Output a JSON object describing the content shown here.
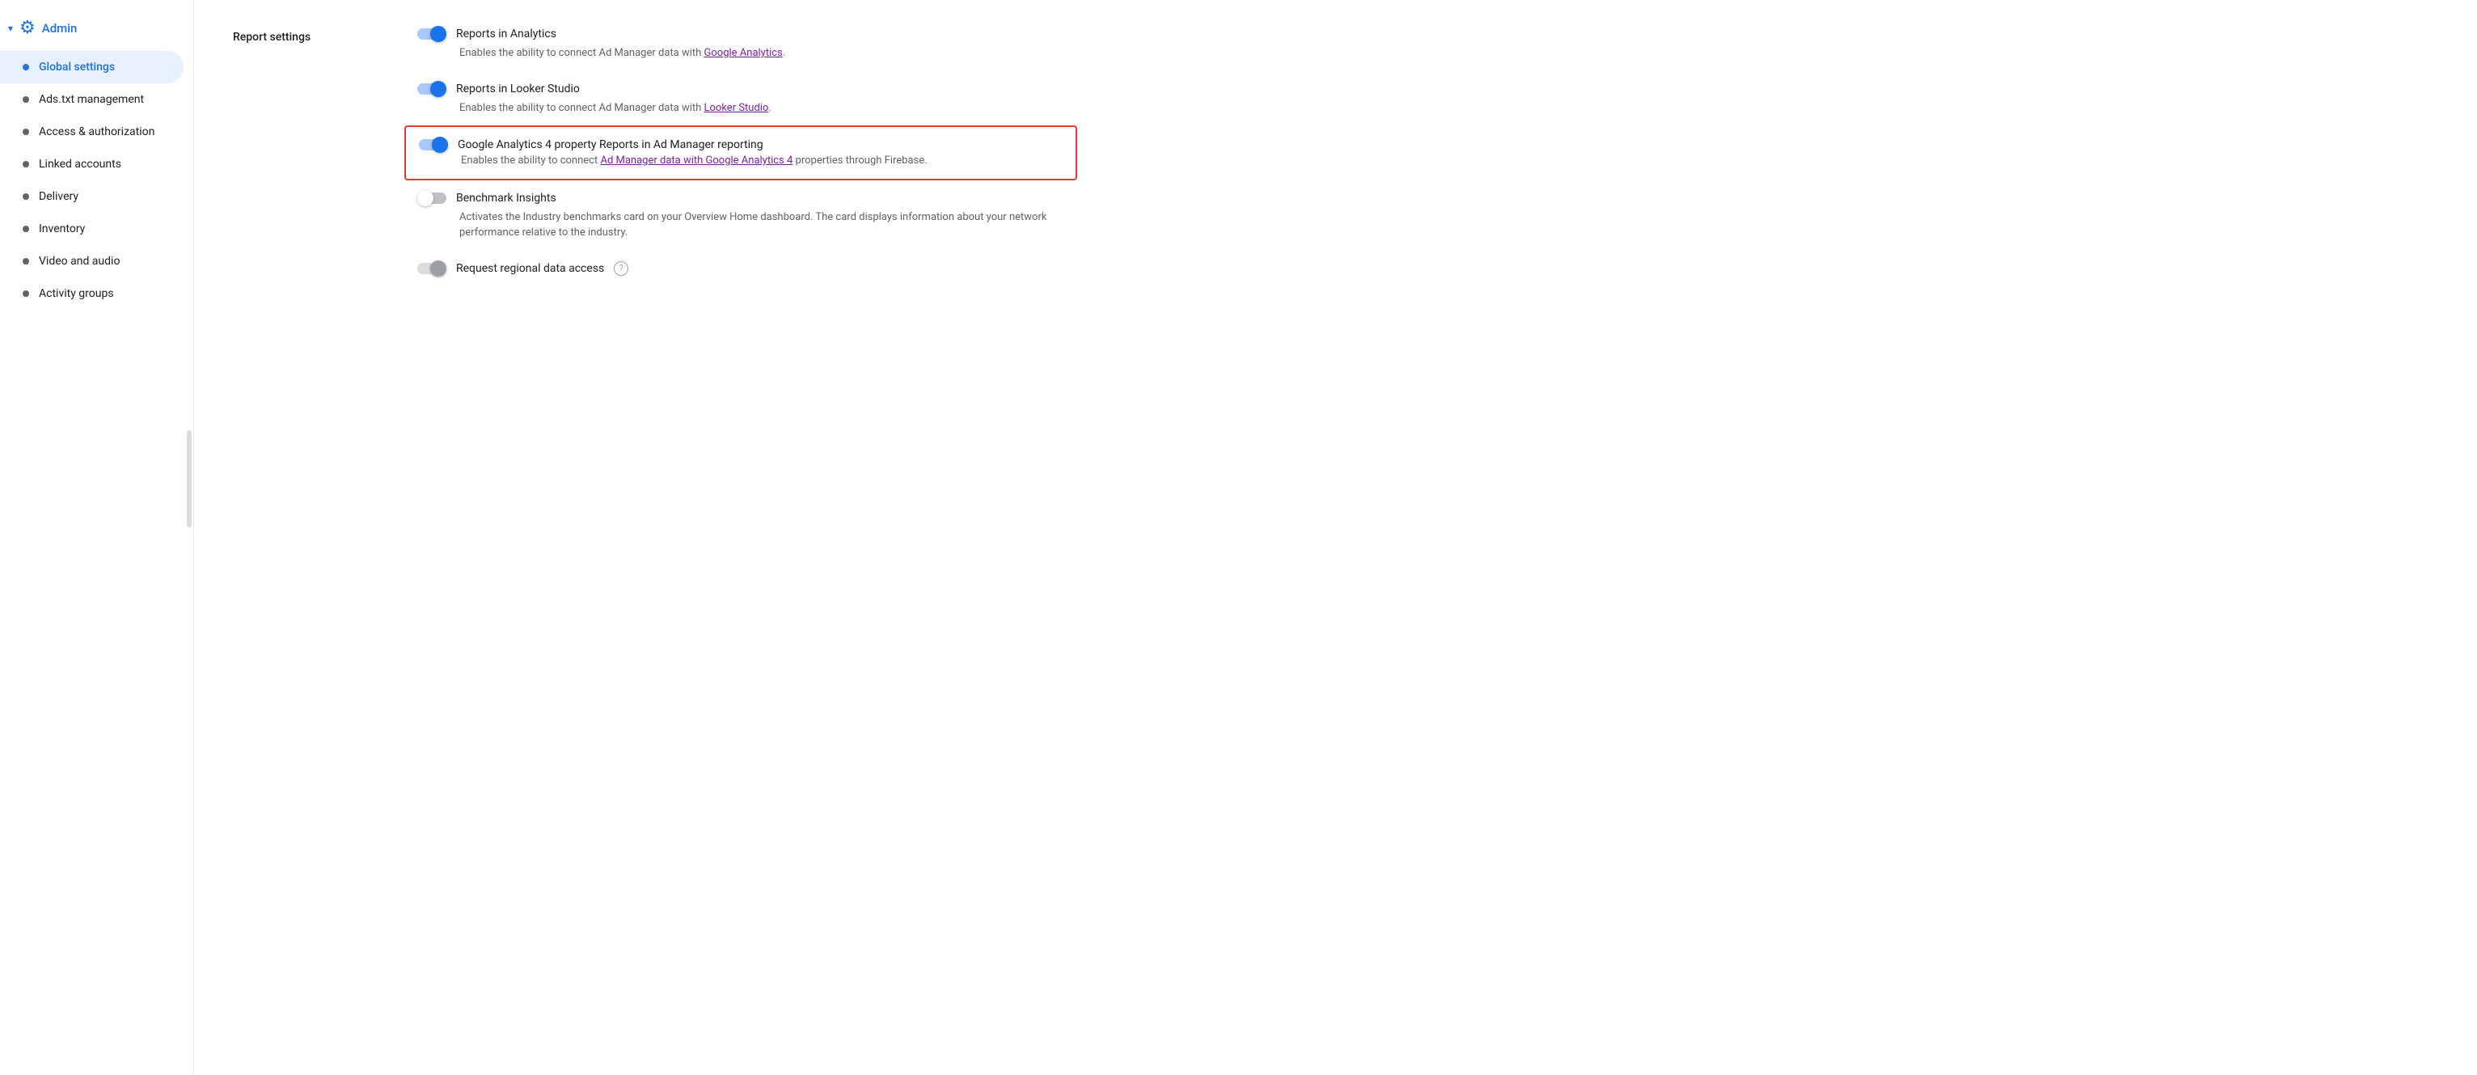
{
  "sidebar": {
    "header": {
      "title": "Admin",
      "arrow": "▾",
      "icon": "🔧"
    },
    "items": [
      {
        "id": "global-settings",
        "label": "Global settings",
        "active": true
      },
      {
        "id": "ads-txt",
        "label": "Ads.txt management",
        "active": false
      },
      {
        "id": "access-authorization",
        "label": "Access & authorization",
        "active": false
      },
      {
        "id": "linked-accounts",
        "label": "Linked accounts",
        "active": false
      },
      {
        "id": "delivery",
        "label": "Delivery",
        "active": false
      },
      {
        "id": "inventory",
        "label": "Inventory",
        "active": false
      },
      {
        "id": "video-audio",
        "label": "Video and audio",
        "active": false
      },
      {
        "id": "activity-groups",
        "label": "Activity groups",
        "active": false
      }
    ]
  },
  "main": {
    "section_title": "Report settings",
    "settings": [
      {
        "id": "reports-analytics",
        "label": "Reports in Analytics",
        "toggle_state": "on",
        "description": "Enables the ability to connect Ad Manager data with",
        "link_text": "Google Analytics",
        "description_after": ".",
        "highlighted": false
      },
      {
        "id": "reports-looker",
        "label": "Reports in Looker Studio",
        "toggle_state": "on",
        "description": "Enables the ability to connect Ad Manager data with",
        "link_text": "Looker Studio",
        "description_after": ".",
        "highlighted": false
      },
      {
        "id": "reports-ga4",
        "label": "Google Analytics 4 property Reports in Ad Manager reporting",
        "toggle_state": "on",
        "description": "Enables the ability to connect",
        "link_text": "Ad Manager data with Google Analytics 4",
        "description_after": " properties through Firebase.",
        "highlighted": true
      },
      {
        "id": "benchmark-insights",
        "label": "Benchmark Insights",
        "toggle_state": "off",
        "description": "Activates the Industry benchmarks card on your Overview Home dashboard. The card displays information about your network performance relative to the industry.",
        "link_text": "",
        "description_after": "",
        "highlighted": false
      },
      {
        "id": "regional-data",
        "label": "Request regional data access",
        "toggle_state": "disabled",
        "description": "",
        "link_text": "",
        "description_after": "",
        "highlighted": false,
        "has_info": true
      }
    ]
  }
}
